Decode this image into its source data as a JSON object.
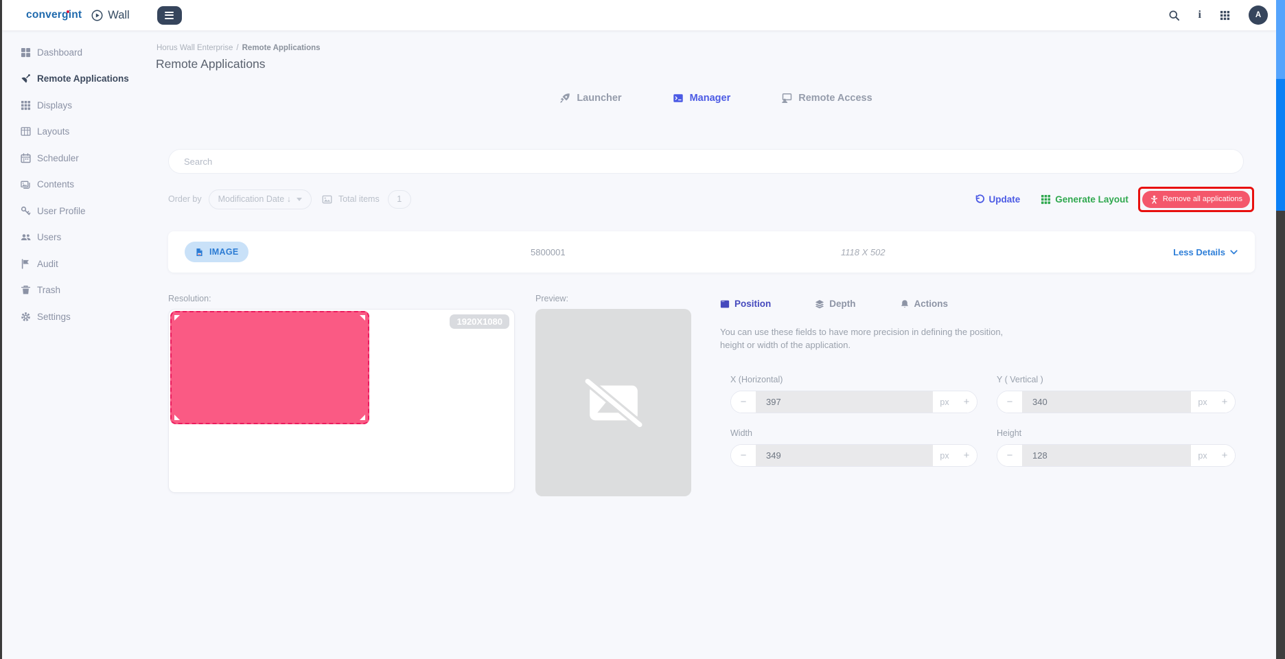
{
  "topbar": {
    "brand": "convergint",
    "product": "Wall",
    "info_icon_glyph": "i",
    "avatar_initial": "A"
  },
  "sidebar": {
    "items": [
      {
        "label": "Dashboard",
        "icon": "dashboard-grid-icon",
        "active": false
      },
      {
        "label": "Remote Applications",
        "icon": "satellite-dish-icon",
        "active": true
      },
      {
        "label": "Displays",
        "icon": "displays-grid-icon",
        "active": false
      },
      {
        "label": "Layouts",
        "icon": "layout-table-icon",
        "active": false
      },
      {
        "label": "Scheduler",
        "icon": "calendar-icon",
        "active": false
      },
      {
        "label": "Contents",
        "icon": "media-icon",
        "active": false
      },
      {
        "label": "User Profile",
        "icon": "key-icon",
        "active": false
      },
      {
        "label": "Users",
        "icon": "users-icon",
        "active": false
      },
      {
        "label": "Audit",
        "icon": "flag-icon",
        "active": false
      },
      {
        "label": "Trash",
        "icon": "trash-icon",
        "active": false
      },
      {
        "label": "Settings",
        "icon": "gear-icon",
        "active": false
      }
    ]
  },
  "breadcrumb": {
    "parent": "Horus Wall Enterprise",
    "separator": "/",
    "current": "Remote Applications"
  },
  "page": {
    "title": "Remote Applications"
  },
  "tabs": [
    {
      "label": "Launcher",
      "icon": "rocket-icon",
      "active": false
    },
    {
      "label": "Manager",
      "icon": "manager-window-icon",
      "active": true
    },
    {
      "label": "Remote Access",
      "icon": "remote-access-icon",
      "active": false
    }
  ],
  "search": {
    "placeholder": "Search"
  },
  "controls": {
    "order_by_label": "Order by",
    "order_by_value": "Modification Date ↓",
    "total_items_label": "Total items",
    "total_items_count": "1"
  },
  "actions": {
    "update_label": "Update",
    "generate_layout_label": "Generate Layout",
    "remove_all_label": "Remove all applications"
  },
  "item": {
    "type_badge": "IMAGE",
    "id": "5800001",
    "dimensions": "1118 X 502",
    "details_toggle_label": "Less Details"
  },
  "details": {
    "resolution_label": "Resolution:",
    "resolution_badge": "1920X1080",
    "preview_label": "Preview:",
    "panel_tabs": [
      {
        "label": "Position",
        "icon": "position-window-icon",
        "active": true
      },
      {
        "label": "Depth",
        "icon": "layers-icon",
        "active": false
      },
      {
        "label": "Actions",
        "icon": "bell-icon",
        "active": false
      }
    ],
    "description_line1": "You can use these fields to have more precision in defining the position,",
    "description_line2": "height or width of the application.",
    "fields": [
      {
        "label": "X (Horizontal)",
        "value": "397",
        "unit": "px"
      },
      {
        "label": "Y ( Vertical )",
        "value": "340",
        "unit": "px"
      },
      {
        "label": "Width",
        "value": "349",
        "unit": "px"
      },
      {
        "label": "Height",
        "value": "128",
        "unit": "px"
      }
    ],
    "stepper": {
      "decrement": "−",
      "increment": "+"
    }
  },
  "colors": {
    "accent_blue": "#4b5ae4",
    "accent_green": "#2fa84e",
    "danger_red": "#f4576b",
    "annotation_red": "#e8100e",
    "selection_pink": "#fa5a84",
    "selection_pink_border": "#ea1c5e",
    "badge_blue_bg": "#c9e1f8",
    "badge_blue_text": "#2b7bd3",
    "link_blue": "#2f7fd8",
    "brand_blue": "#1e69ad"
  }
}
